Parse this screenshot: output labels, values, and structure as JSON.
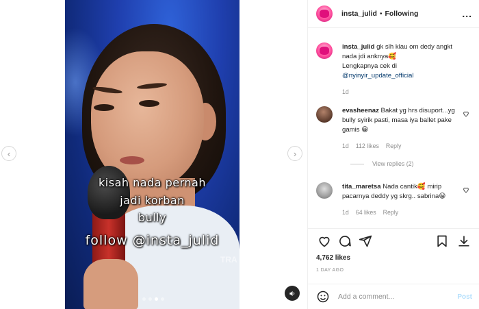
{
  "media": {
    "captions": [
      "kisah nada pernah",
      "jadi korban",
      "bully",
      "follow @insta_julid"
    ],
    "watermark": "TRA",
    "carousel_dots": 4,
    "active_dot": 2,
    "nav_prev_icon": "chevron-left-icon",
    "nav_next_icon": "chevron-right-icon",
    "sound_icon": "speaker-icon"
  },
  "header": {
    "username": "insta_julid",
    "separator": "•",
    "follow_status": "Following",
    "more_icon": "more-horizontal-icon",
    "more_label": "..."
  },
  "caption_post": {
    "username": "insta_julid",
    "text": "gk slh klau om dedy angkt nada jdi anknya🥰",
    "line2": "Lengkapnya cek di",
    "mention": "@nyinyir_update_official",
    "age": "1d"
  },
  "comments": [
    {
      "username": "evasheenaz",
      "text": "Bakat yg hrs disuport...yg bully syirik pasti, masa iya ballet pake gamis 😀",
      "age": "1d",
      "likes": "112 likes",
      "reply": "Reply"
    },
    {
      "username": "tita_maretsa",
      "text": "Nada cantik🥰 mirip pacarnya deddy yg skrg.. sabrina😀",
      "age": "1d",
      "likes": "64 likes",
      "reply": "Reply"
    }
  ],
  "view_replies": "View replies (2)",
  "actions": {
    "like_icon": "heart-icon",
    "comment_icon": "comment-icon",
    "share_icon": "share-icon",
    "save_icon": "bookmark-icon",
    "download_icon": "download-icon"
  },
  "likes_count": "4,762 likes",
  "posted_ago": "1 DAY AGO",
  "add_comment": {
    "placeholder": "Add a comment...",
    "post_label": "Post",
    "emoji_icon": "emoji-icon"
  },
  "colors": {
    "link": "#00376b",
    "post_button": "#b3dffc",
    "meta": "#8e8e8e"
  }
}
